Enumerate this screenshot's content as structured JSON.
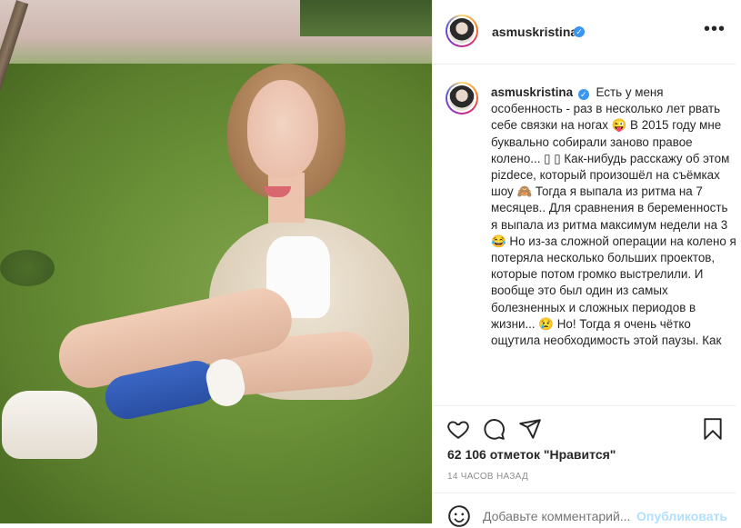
{
  "post": {
    "username": "asmuskristina",
    "verified": true,
    "caption_username": "asmuskristina",
    "caption_text": "Есть у меня особенность - раз в несколько лет рвать себе связки на ногах 😜 В 2015 году мне буквально собирали заново правое колено... ▯ ▯ Как-нибудь расскажу об этом pizdece, который произошёл на съёмках шоу 🙈 Тогда я выпала из ритма на 7 месяцев.. Для сравнения в беременность я выпала из ритма максимум недели на 3 😂 Но из-за сложной операции на колено я потеряла несколько больших проектов, которые потом громко выстрелили. И вообще это был один из самых болезненных и сложных периодов в жизни... 😢 Но! Тогда я очень чётко ощутила необходимость этой паузы. Как",
    "likes": "62 106 отметок \"Нравится\"",
    "time": "14 ЧАСОВ НАЗАД"
  },
  "comment": {
    "placeholder": "Добавьте комментарий...",
    "publish_label": "Опубликовать"
  },
  "icons": {
    "more": "more-options-icon",
    "like": "heart-icon",
    "comment": "comment-icon",
    "share": "paper-plane-icon",
    "save": "bookmark-icon",
    "emoji": "emoji-icon"
  },
  "colors": {
    "verified": "#3897f0",
    "publish": "#b2dffc",
    "muted": "#8e8e8e",
    "text": "#262626"
  }
}
